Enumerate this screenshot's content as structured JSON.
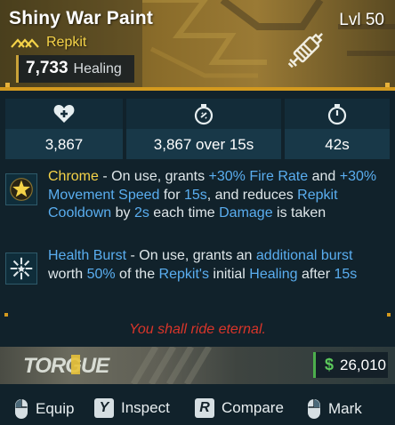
{
  "item": {
    "name": "Shiny War Paint",
    "level": "Lvl 50",
    "type": "Repkit",
    "healing_value": "7,733",
    "healing_label": "Healing",
    "rarity_color": "#f5d348"
  },
  "stats": [
    {
      "icon": "heart-plus-icon",
      "value": "3,867"
    },
    {
      "icon": "timer-heal-icon",
      "value": "3,867 over 15s"
    },
    {
      "icon": "cooldown-timer-icon",
      "value": "42s"
    }
  ],
  "perks": [
    {
      "icon": "chrome-star-icon",
      "name": "Chrome",
      "t1": " - On use, grants ",
      "h1": "+30% Fire Rate",
      "t2": " and ",
      "h2": "+30% Movement Speed",
      "t3": " for ",
      "h3": "15s",
      "t4": ", and reduces ",
      "h4": "Repkit Cooldown",
      "t5": " by ",
      "h5": "2s",
      "t6": " each time ",
      "h6": "Damage",
      "t7": " is taken"
    },
    {
      "icon": "health-burst-icon",
      "name": "Health Burst",
      "t1": " - On use, grants an ",
      "h1": "additional burst",
      "t2": " worth ",
      "h2": "50%",
      "t3": " of the ",
      "h3": "Repkit's",
      "t4": " initial ",
      "h4": "Healing",
      "t5": " after ",
      "h5": "15s"
    }
  ],
  "flavor_text": "You shall ride eternal.",
  "manufacturer": {
    "name": "TORGUE"
  },
  "price": {
    "symbol": "$",
    "value": "26,010"
  },
  "actions": [
    {
      "icon": "mouse-left-icon",
      "key": "",
      "label": "Equip"
    },
    {
      "icon": "",
      "key": "Y",
      "label": "Inspect"
    },
    {
      "icon": "",
      "key": "R",
      "label": "Compare"
    },
    {
      "icon": "mouse-right-icon",
      "key": "",
      "label": "Mark"
    }
  ],
  "colors": {
    "accent_gold": "#d49a1e",
    "highlight_blue": "#5aaef0",
    "flavor_red": "#d9352a",
    "price_green": "#5cc95c"
  }
}
